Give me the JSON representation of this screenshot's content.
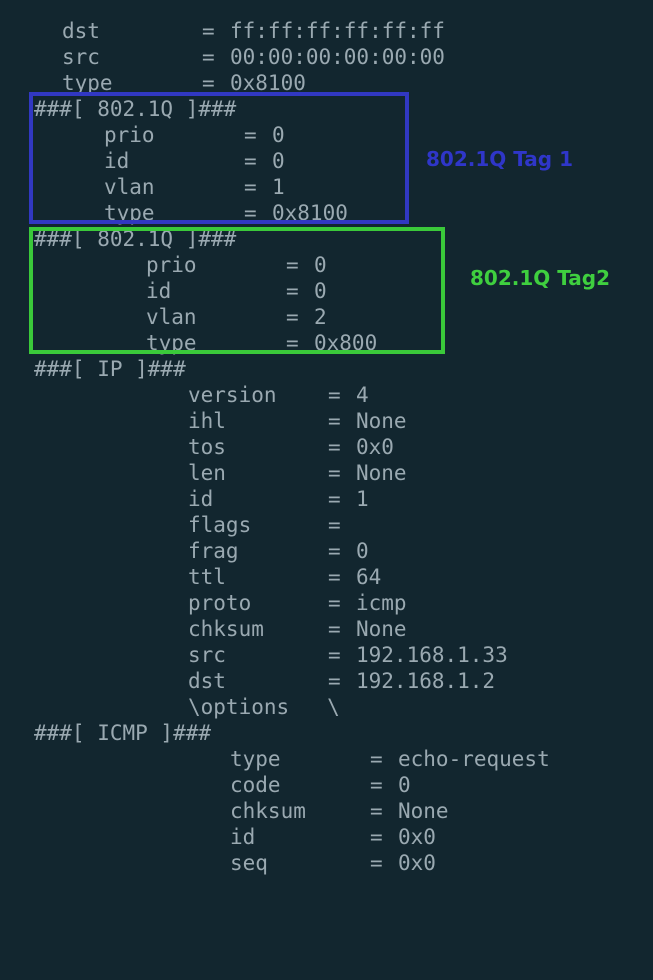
{
  "colors": {
    "background": "#12262f",
    "text": "#9aa9b1",
    "tag1_box": "#3138c2",
    "tag2_box": "#3ac93a"
  },
  "annotations": {
    "tag1": "802.1Q Tag 1",
    "tag2": "802.1Q Tag2"
  },
  "ether": [
    {
      "key": "dst",
      "value": "ff:ff:ff:ff:ff:ff"
    },
    {
      "key": "src",
      "value": "00:00:00:00:00:00"
    },
    {
      "key": "type",
      "value": "0x8100"
    }
  ],
  "dot1q_1": {
    "header": "###[ 802.1Q ]###",
    "fields": [
      {
        "key": "prio",
        "value": "0"
      },
      {
        "key": "id",
        "value": "0"
      },
      {
        "key": "vlan",
        "value": "1"
      },
      {
        "key": "type",
        "value": "0x8100"
      }
    ]
  },
  "dot1q_2": {
    "header": "###[ 802.1Q ]###",
    "fields": [
      {
        "key": "prio",
        "value": "0"
      },
      {
        "key": "id",
        "value": "0"
      },
      {
        "key": "vlan",
        "value": "2"
      },
      {
        "key": "type",
        "value": "0x800"
      }
    ]
  },
  "ip": {
    "header": "###[ IP ]###",
    "fields": [
      {
        "key": "version",
        "value": "4"
      },
      {
        "key": "ihl",
        "value": "None"
      },
      {
        "key": "tos",
        "value": "0x0"
      },
      {
        "key": "len",
        "value": "None"
      },
      {
        "key": "id",
        "value": "1"
      },
      {
        "key": "flags",
        "value": ""
      },
      {
        "key": "frag",
        "value": "0"
      },
      {
        "key": "ttl",
        "value": "64"
      },
      {
        "key": "proto",
        "value": "icmp"
      },
      {
        "key": "chksum",
        "value": "None"
      },
      {
        "key": "src",
        "value": "192.168.1.33"
      },
      {
        "key": "dst",
        "value": "192.168.1.2"
      }
    ],
    "options_line": "\\options   \\"
  },
  "icmp": {
    "header": "###[ ICMP ]###",
    "fields": [
      {
        "key": "type",
        "value": "echo-request"
      },
      {
        "key": "code",
        "value": "0"
      },
      {
        "key": "chksum",
        "value": "None"
      },
      {
        "key": "id",
        "value": "0x0"
      },
      {
        "key": "seq",
        "value": "0x0"
      }
    ]
  },
  "eq_sign": "="
}
